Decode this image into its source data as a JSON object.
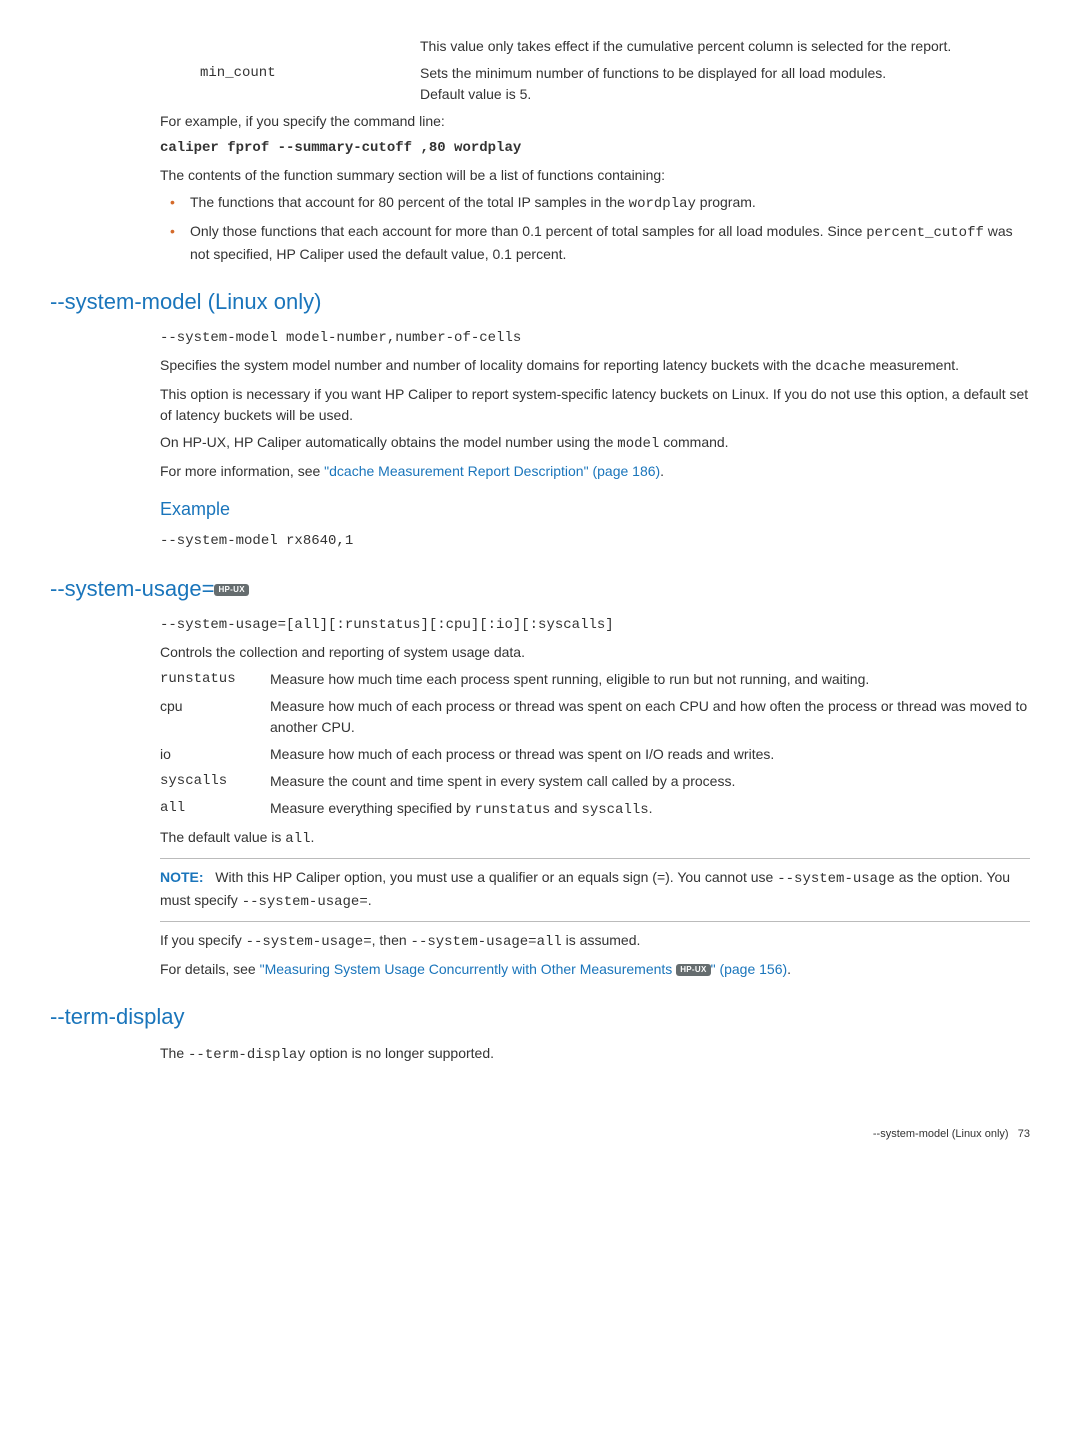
{
  "intro": {
    "def1_desc_cont": "This value only takes effect if the cumulative percent column is selected for the report.",
    "def2_term": "min_count",
    "def2_desc_l1": "Sets the minimum number of functions to be displayed for all load modules.",
    "def2_desc_l2": "Default value is 5.",
    "p1": "For example, if you specify the command line:",
    "cmd": "caliper fprof --summary-cutoff ,80 wordplay",
    "p2": "The contents of the function summary section will be a list of functions containing:",
    "b1a": "The functions that account for 80 percent of the total IP samples in the ",
    "b1b_mono": "wordplay",
    "b1c": " program.",
    "b2a": "Only those functions that each account for more than 0.1 percent of total samples for all load modules. Since ",
    "b2b_mono": "percent_cutoff",
    "b2c": " was not specified, HP Caliper used the default value, 0.1 percent."
  },
  "system_model": {
    "heading": "--system-model (Linux only)",
    "syntax": "--system-model model-number,number-of-cells",
    "p1a": "Specifies the system model number and number of locality domains for reporting latency buckets with the ",
    "p1b_mono": "dcache",
    "p1c": " measurement.",
    "p2": "This option is necessary if you want HP Caliper to report system-specific latency buckets on Linux. If you do not use this option, a default set of latency buckets will be used.",
    "p3a": "On HP-UX, HP Caliper automatically obtains the model number using the ",
    "p3b_mono": "model",
    "p3c": " command.",
    "p4a": "For more information, see ",
    "p4_link": "\"dcache Measurement Report Description\" (page 186)",
    "p4b": ".",
    "example_heading": "Example",
    "example_code": "--system-model rx8640,1"
  },
  "system_usage": {
    "heading": "--system-usage=",
    "badge": "HP-UX",
    "syntax": "--system-usage=[all][:runstatus][:cpu][:io][:syscalls]",
    "p1": "Controls the collection and reporting of system usage data.",
    "defs": {
      "runstatus_term": "runstatus",
      "runstatus_desc": "Measure how much time each process spent running, eligible to run but not running, and waiting.",
      "cpu_term": "cpu",
      "cpu_desc": "Measure how much of each process or thread was spent on each CPU and how often the process or thread was moved to another CPU.",
      "io_term": "io",
      "io_desc": "Measure how much of each process or thread was spent on I/O reads and writes.",
      "syscalls_term": "syscalls",
      "syscalls_desc": "Measure the count and time spent in every system call called by a process.",
      "all_term": "all",
      "all_desc_a": "Measure everything specified by ",
      "all_desc_b_mono": "runstatus",
      "all_desc_c": " and ",
      "all_desc_d_mono": "syscalls",
      "all_desc_e": "."
    },
    "p2a": "The default value is ",
    "p2b_mono": "all",
    "p2c": ".",
    "note_label": "NOTE:",
    "note_a": "With this HP Caliper option, you must use a qualifier or an equals sign (=). You cannot use ",
    "note_b_mono": "--system-usage",
    "note_c": " as the option. You must specify ",
    "note_d_mono": "--system-usage=",
    "note_e": ".",
    "p3a": "If you specify ",
    "p3b_mono": "--system-usage=",
    "p3c": ", then ",
    "p3d_mono": "--system-usage=all",
    "p3e": " is assumed.",
    "p4a": "For details, see ",
    "p4_link": "\"Measuring System Usage Concurrently with Other Measurements ",
    "p4_link_end": "\" (page 156)",
    "p4b": "."
  },
  "term_display": {
    "heading": "--term-display",
    "p1a": "The ",
    "p1b_mono": "--term-display",
    "p1c": " option is no longer supported."
  },
  "footer": {
    "text": "--system-model (Linux only)",
    "page": "73"
  }
}
